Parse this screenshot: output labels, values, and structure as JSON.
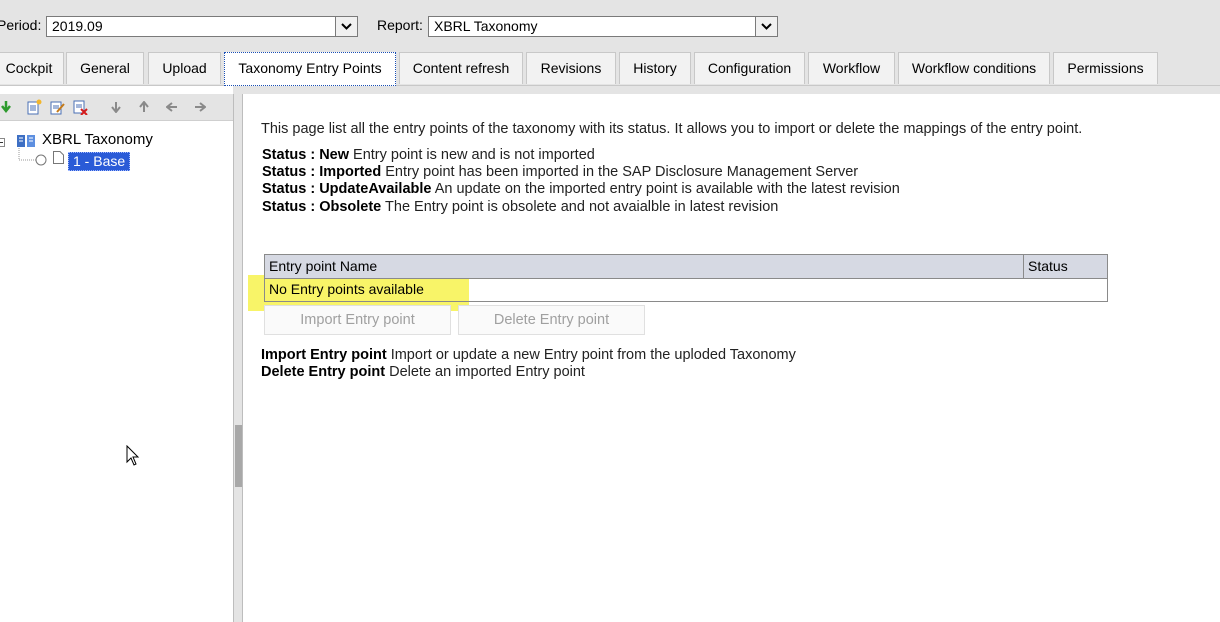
{
  "filters": {
    "period_label": "Period:",
    "period_value": "2019.09",
    "report_label": "Report:",
    "report_value": "XBRL Taxonomy"
  },
  "tabs": [
    {
      "label": "Cockpit"
    },
    {
      "label": "General"
    },
    {
      "label": "Upload"
    },
    {
      "label": "Taxonomy Entry Points",
      "active": true
    },
    {
      "label": "Content refresh"
    },
    {
      "label": "Revisions"
    },
    {
      "label": "History"
    },
    {
      "label": "Configuration"
    },
    {
      "label": "Workflow"
    },
    {
      "label": "Workflow conditions"
    },
    {
      "label": "Permissions"
    }
  ],
  "tree": {
    "root_label": "XBRL Taxonomy",
    "child_label": "1 - Base"
  },
  "toolbar_icons": [
    "download-icon",
    "new-document-icon",
    "edit-document-icon",
    "delete-document-icon",
    "move-down-icon",
    "move-up-icon",
    "move-left-icon",
    "move-right-icon"
  ],
  "main": {
    "description": "This page list all the entry points of the taxonomy with its status. It allows you to import or delete the mappings of the entry point.",
    "statuses": [
      {
        "key": "Status : New",
        "text": "Entry point is new and is not imported"
      },
      {
        "key": "Status : Imported",
        "text": "Entry point has been imported in the SAP Disclosure Management Server"
      },
      {
        "key": "Status : UpdateAvailable",
        "text": "An update on the imported entry point is available with the latest revision"
      },
      {
        "key": "Status : Obsolete",
        "text": "The Entry point is obsolete and not avaialble in latest revision"
      }
    ],
    "grid": {
      "col_name": "Entry point Name",
      "col_status": "Status",
      "empty_message": "No Entry points available"
    },
    "buttons": {
      "import": "Import Entry point",
      "delete": "Delete Entry point"
    },
    "help": [
      {
        "key": "Import Entry point",
        "text": "Import or update a new Entry point from the uploded Taxonomy"
      },
      {
        "key": "Delete Entry point",
        "text": "Delete an imported Entry point"
      }
    ]
  }
}
